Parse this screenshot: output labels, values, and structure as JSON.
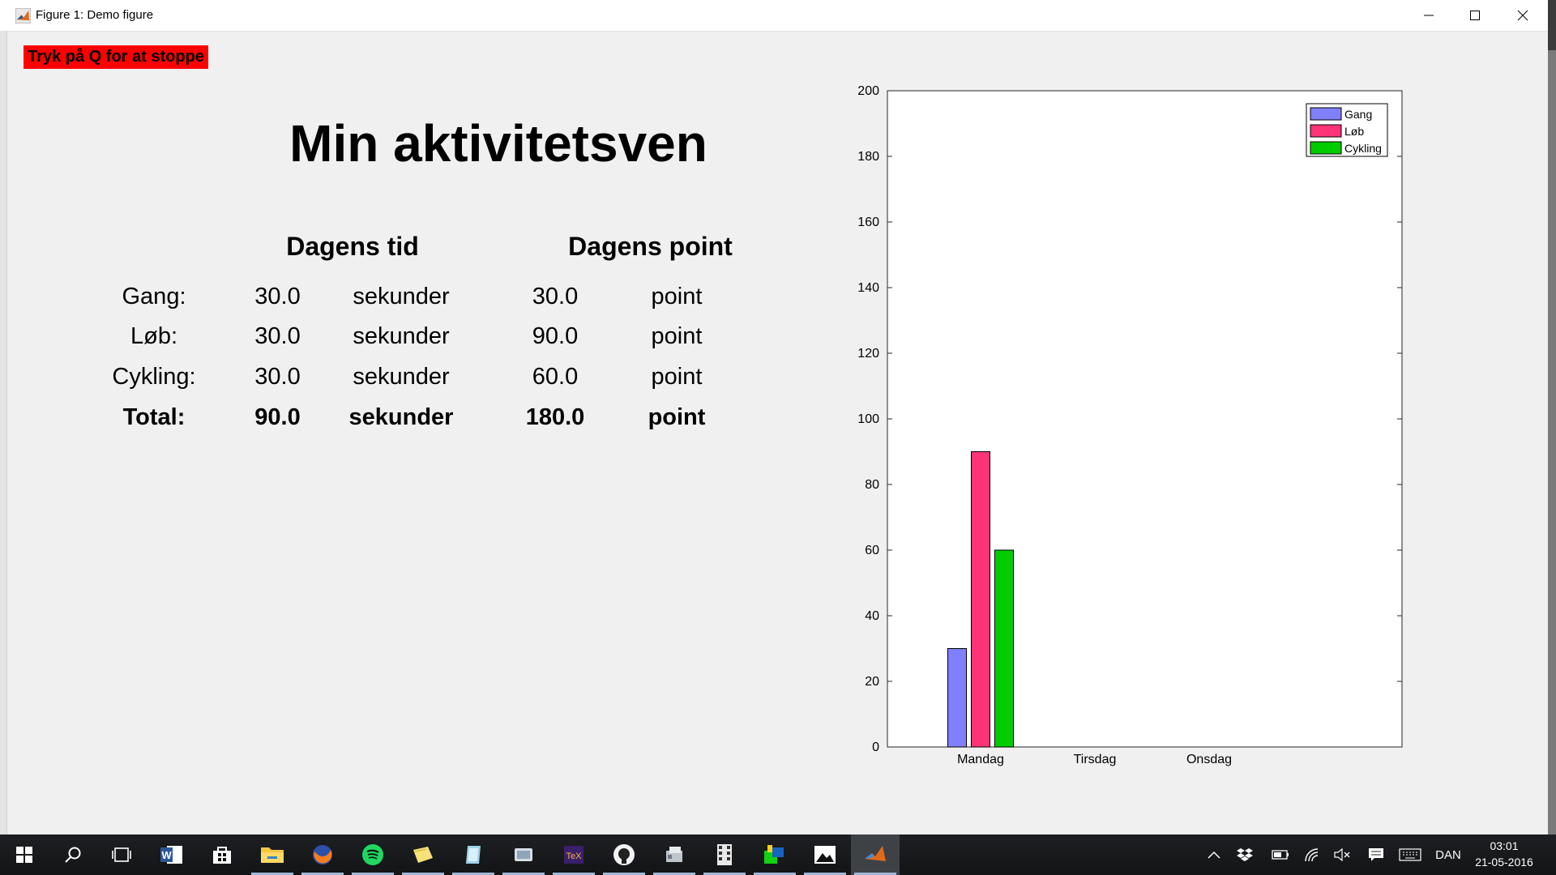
{
  "window": {
    "title": "Figure 1: Demo figure"
  },
  "figure": {
    "stop_hint": "Tryk på Q for at stoppe",
    "title": "Min aktivitetsven",
    "headers": {
      "time": "Dagens tid",
      "points": "Dagens point"
    },
    "rows": [
      {
        "label": "Gang:",
        "time": "30.0",
        "time_unit": "sekunder",
        "points": "30.0",
        "points_unit": "point"
      },
      {
        "label": "Løb:",
        "time": "30.0",
        "time_unit": "sekunder",
        "points": "90.0",
        "points_unit": "point"
      },
      {
        "label": "Cykling:",
        "time": "30.0",
        "time_unit": "sekunder",
        "points": "60.0",
        "points_unit": "point"
      }
    ],
    "total": {
      "label": "Total:",
      "time": "90.0",
      "time_unit": "sekunder",
      "points": "180.0",
      "points_unit": "point"
    }
  },
  "chart_data": {
    "type": "bar",
    "categories": [
      "Mandag",
      "Tirsdag",
      "Onsdag"
    ],
    "series": [
      {
        "name": "Gang",
        "values": [
          30,
          0,
          0
        ],
        "color": "#8080ff"
      },
      {
        "name": "Løb",
        "values": [
          90,
          0,
          0
        ],
        "color": "#ff3377"
      },
      {
        "name": "Cykling",
        "values": [
          60,
          0,
          0
        ],
        "color": "#00cc00"
      }
    ],
    "ylim": [
      0,
      200
    ],
    "yticks": [
      0,
      20,
      40,
      60,
      80,
      100,
      120,
      140,
      160,
      180,
      200
    ],
    "legend_position": "top-right",
    "grid": false,
    "title": "",
    "xlabel": "",
    "ylabel": ""
  },
  "taskbar": {
    "apps": [
      "start-icon",
      "search-icon",
      "task-view-icon",
      "word-icon",
      "store-icon",
      "file-explorer-icon",
      "firefox-icon",
      "spotify-icon",
      "sticky-notes-icon",
      "app-icon",
      "app-icon",
      "texmaker-icon",
      "github-icon",
      "app-icon",
      "app-icon",
      "app-icon",
      "photos-icon",
      "matlab-icon"
    ],
    "language": "DAN",
    "time": "03:01",
    "date": "21-05-2016"
  }
}
